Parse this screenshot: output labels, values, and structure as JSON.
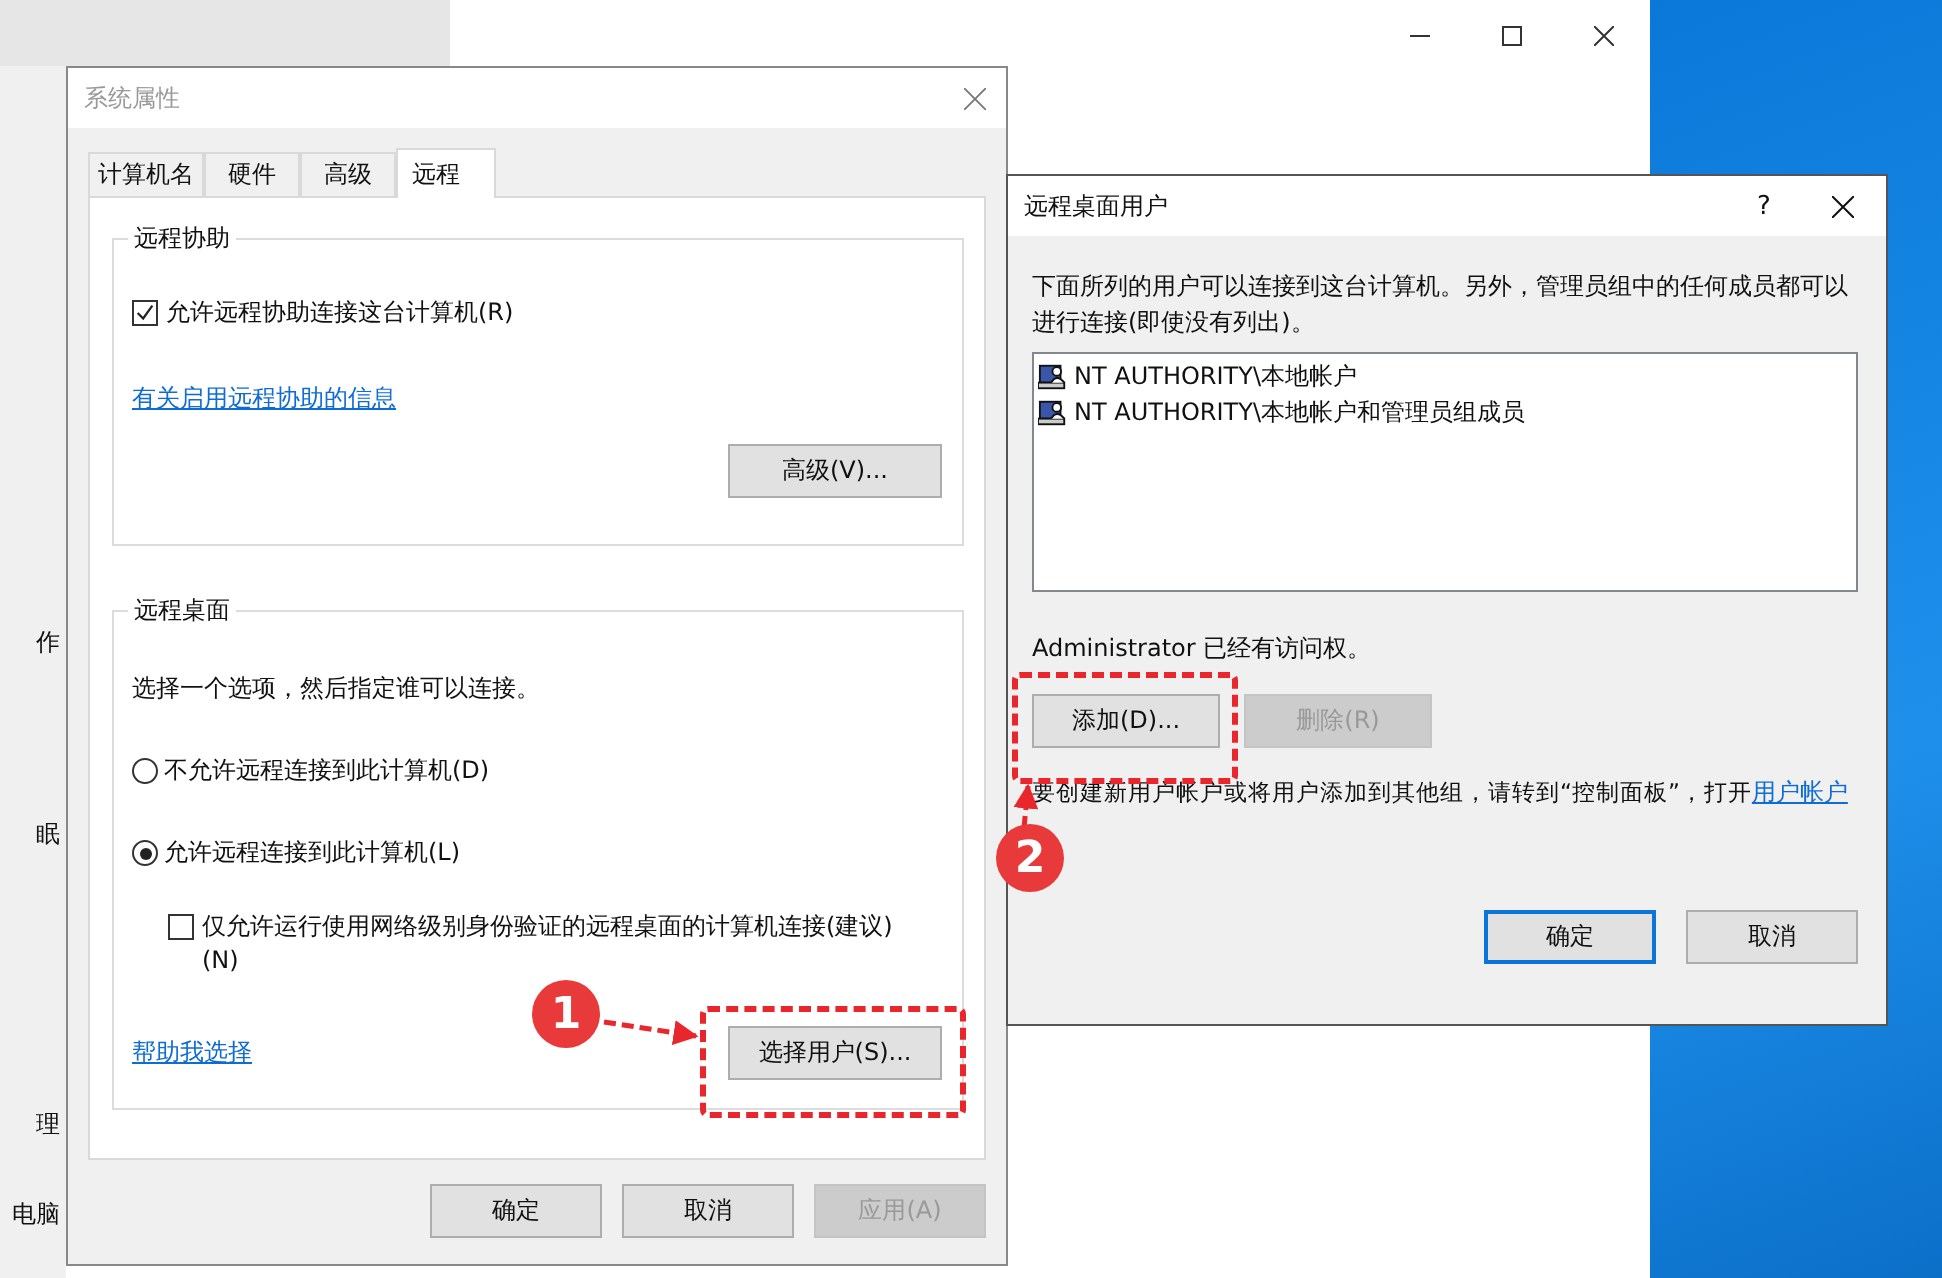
{
  "background_window": {
    "sidebar_fragments": [
      "作",
      "眠",
      "理",
      "电脑"
    ]
  },
  "system_properties": {
    "title": "系统属性",
    "tabs": [
      {
        "label": "计算机名",
        "selected": false
      },
      {
        "label": "硬件",
        "selected": false
      },
      {
        "label": "高级",
        "selected": false
      },
      {
        "label": "远程",
        "selected": true
      }
    ],
    "remote_assistance": {
      "title": "远程协助",
      "checkbox": {
        "label": "允许远程协助连接这台计算机(R)",
        "checked": true
      },
      "link": "有关启用远程协助的信息",
      "advanced_button": "高级(V)..."
    },
    "remote_desktop": {
      "title": "远程桌面",
      "instruction": "选择一个选项，然后指定谁可以连接。",
      "options": [
        {
          "label": "不允许远程连接到此计算机(D)",
          "selected": false
        },
        {
          "label": "允许远程连接到此计算机(L)",
          "selected": true
        }
      ],
      "nla_checkbox": {
        "label": "仅允许运行使用网络级别身份验证的远程桌面的计算机连接(建议)(N)",
        "checked": false
      },
      "help_link": "帮助我选择",
      "select_users_button": "选择用户(S)..."
    },
    "buttons": [
      {
        "label": "确定",
        "disabled": false
      },
      {
        "label": "取消",
        "disabled": false
      },
      {
        "label": "应用(A)",
        "disabled": true
      }
    ]
  },
  "remote_desktop_users": {
    "title": "远程桌面用户",
    "help": "?",
    "description": "下面所列的用户可以连接到这台计算机。另外，管理员组中的任何成员都可以进行连接(即使没有列出)。",
    "users": [
      "NT AUTHORITY\\本地帐户",
      "NT AUTHORITY\\本地帐户和管理员组成员"
    ],
    "access_note": "Administrator 已经有访问权。",
    "buttons": [
      {
        "label": "添加(D)...",
        "disabled": false
      },
      {
        "label": "删除(R)",
        "disabled": true
      }
    ],
    "footer": {
      "text": "要创建新用户帐户或将用户添加到其他组，请转到“控制面板”，打开",
      "link": "用户帐户"
    },
    "dialog_buttons": [
      {
        "label": "确定",
        "default": true
      },
      {
        "label": "取消",
        "default": false
      }
    ]
  },
  "callouts": [
    {
      "label": "1"
    },
    {
      "label": "2"
    }
  ]
}
